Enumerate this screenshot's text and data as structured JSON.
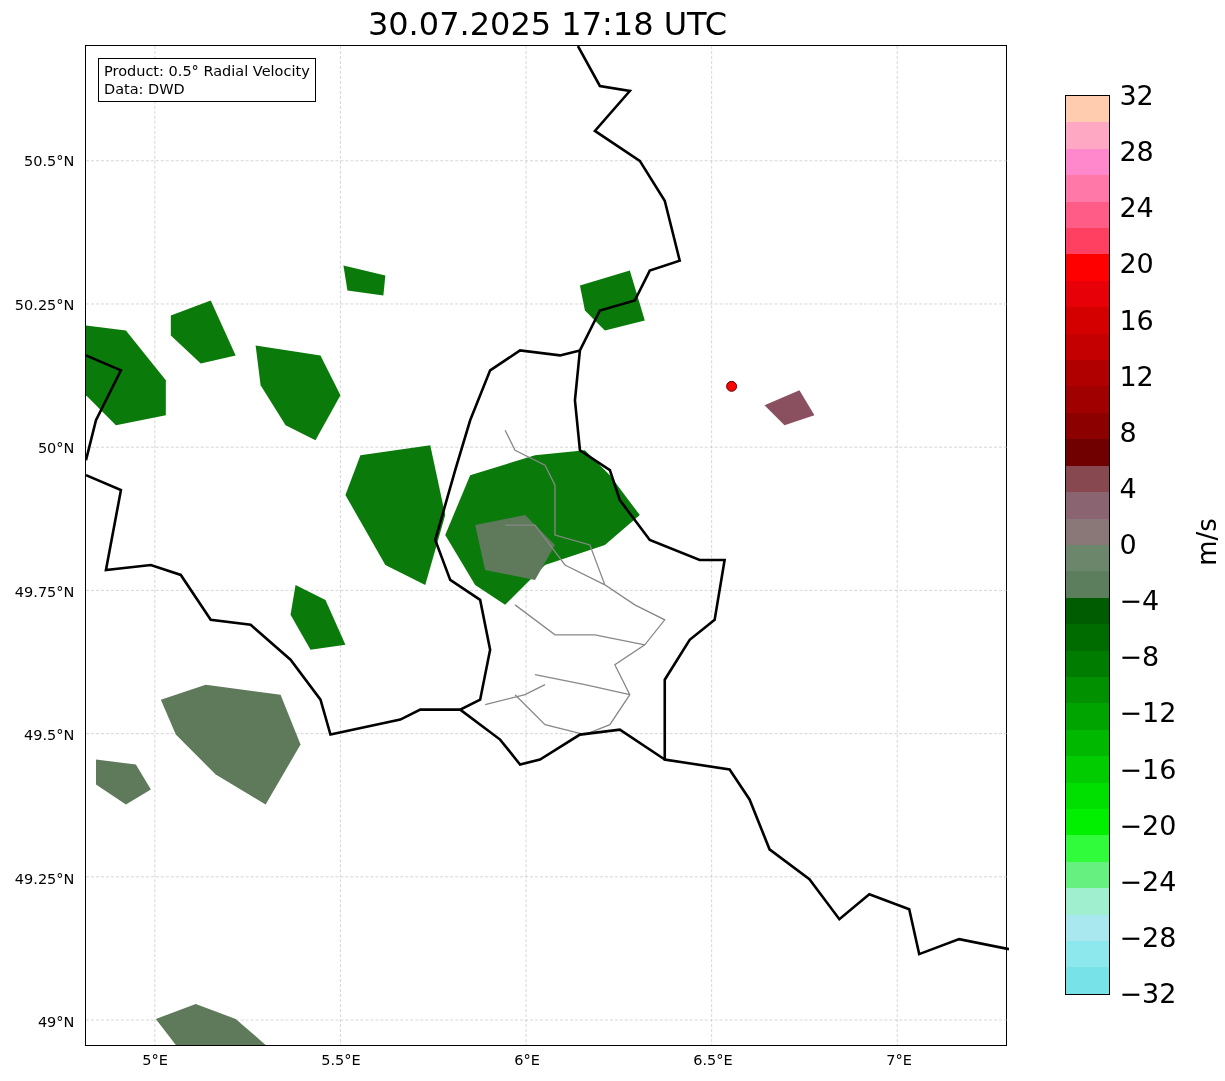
{
  "title": "30.07.2025 17:18 UTC",
  "info_box": {
    "lines": [
      "Product: 0.5° Radial Velocity",
      "Data: DWD"
    ]
  },
  "y_ticks": [
    "50.5°N",
    "50.25°N",
    "50°N",
    "49.75°N",
    "49.5°N",
    "49.25°N",
    "49°N"
  ],
  "x_ticks": [
    "5°E",
    "5.5°E",
    "6°E",
    "6.5°E",
    "7°E"
  ],
  "colorbar": {
    "label": "m/s",
    "ticks": [
      "32",
      "28",
      "24",
      "20",
      "16",
      "12",
      "8",
      "4",
      "0",
      "−4",
      "−8",
      "−12",
      "−16",
      "−20",
      "−24",
      "−28",
      "−32"
    ],
    "segments": [
      {
        "color": "#ffccb0"
      },
      {
        "color": "#ffa8c4"
      },
      {
        "color": "#ff88cc"
      },
      {
        "color": "#ff78a8"
      },
      {
        "color": "#ff5c88"
      },
      {
        "color": "#ff4060"
      },
      {
        "color": "#ff0000"
      },
      {
        "color": "#e80008"
      },
      {
        "color": "#d40000"
      },
      {
        "color": "#c40000"
      },
      {
        "color": "#b00000"
      },
      {
        "color": "#a00000"
      },
      {
        "color": "#8c0000"
      },
      {
        "color": "#700000"
      },
      {
        "color": "#884850"
      },
      {
        "color": "#8a6470"
      },
      {
        "color": "#8a7878"
      },
      {
        "color": "#6b866b"
      },
      {
        "color": "#5c7e5c"
      },
      {
        "color": "#005c00"
      },
      {
        "color": "#006c00"
      },
      {
        "color": "#007c00"
      },
      {
        "color": "#009000"
      },
      {
        "color": "#00a400"
      },
      {
        "color": "#00b800"
      },
      {
        "color": "#00cc00"
      },
      {
        "color": "#00e000"
      },
      {
        "color": "#00f000"
      },
      {
        "color": "#30fc3c"
      },
      {
        "color": "#66f080"
      },
      {
        "color": "#a0f0d0"
      },
      {
        "color": "#a8e8ee"
      },
      {
        "color": "#8ce8ec"
      },
      {
        "color": "#77e3e8"
      }
    ]
  }
}
